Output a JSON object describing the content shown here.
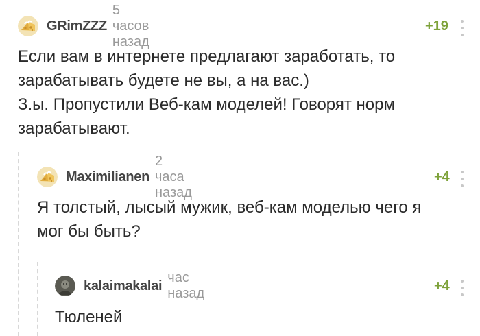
{
  "comments": [
    {
      "author": "GRimZZZ",
      "time": "5 часов назад",
      "rating": "+19",
      "avatar_icon": "default-cheese-avatar-icon",
      "text": "Если вам в интернете предлагают заработать, то\nзарабатывать будете не вы, а на вас.)\nЗ.ы. Пропустили Веб-кам моделей! Говорят норм\nзарабатывают."
    },
    {
      "author": "Maximilianen",
      "time": "2 часа назад",
      "rating": "+4",
      "avatar_icon": "default-cheese-avatar-icon",
      "text": "Я толстый, лысый мужик, веб-кам моделью чего я\nмог бы быть?"
    },
    {
      "author": "kalaimakalai",
      "time": "час назад",
      "rating": "+4",
      "avatar_icon": "user-photo-avatar-icon",
      "text": "Тюленей"
    }
  ],
  "colors": {
    "rating": "#7ea23a",
    "author": "#444444",
    "time": "#9a9a9a",
    "thread_line": "#d8d8d8"
  }
}
